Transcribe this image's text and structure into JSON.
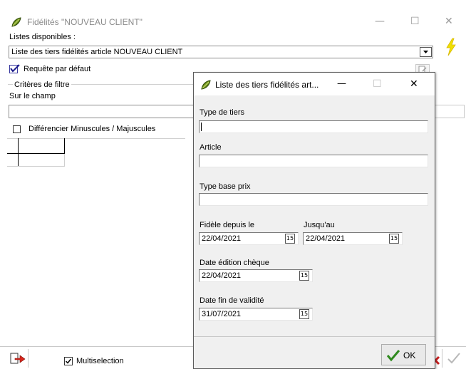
{
  "main_window": {
    "title": "Fidélités \"NOUVEAU CLIENT\"",
    "lists_label": "Listes disponibles :",
    "list_value": "Liste des tiers fidélités article NOUVEAU CLIENT",
    "default_query_label": "Requête par défaut",
    "filter_group_label": "Critères de filtre",
    "field_label": "Sur le champ",
    "field_value": "",
    "case_label": "Différencier Minuscules / Majuscules",
    "multiselection_label": "Multiselection"
  },
  "dialog": {
    "title": "Liste des tiers fidélités art...",
    "type_tiers_label": "Type de tiers",
    "type_tiers_value": "",
    "article_label": "Article",
    "article_value": "",
    "type_base_prix_label": "Type base prix",
    "type_base_prix_value": "",
    "fidele_label": "Fidèle depuis le",
    "fidele_value": "22/04/2021",
    "jusquau_label": "Jusqu'au",
    "jusquau_value": "22/04/2021",
    "date_edition_label": "Date édition chèque",
    "date_edition_value": "22/04/2021",
    "date_fin_label": "Date fin de validité",
    "date_fin_value": "31/07/2021",
    "calendar_glyph": "15",
    "ok_label": "OK"
  },
  "window_controls": {
    "minimize": "—",
    "maximize": "☐",
    "close": "✕"
  },
  "icons": {
    "app": "leaf-icon",
    "lightning": "lightning-icon",
    "export": "export-arrow-icon"
  },
  "colors": {
    "lightning": "#f0e000",
    "ok_check": "#2f8a1e",
    "cancel": "#c81e1e",
    "export_arrow": "#d9261c"
  }
}
